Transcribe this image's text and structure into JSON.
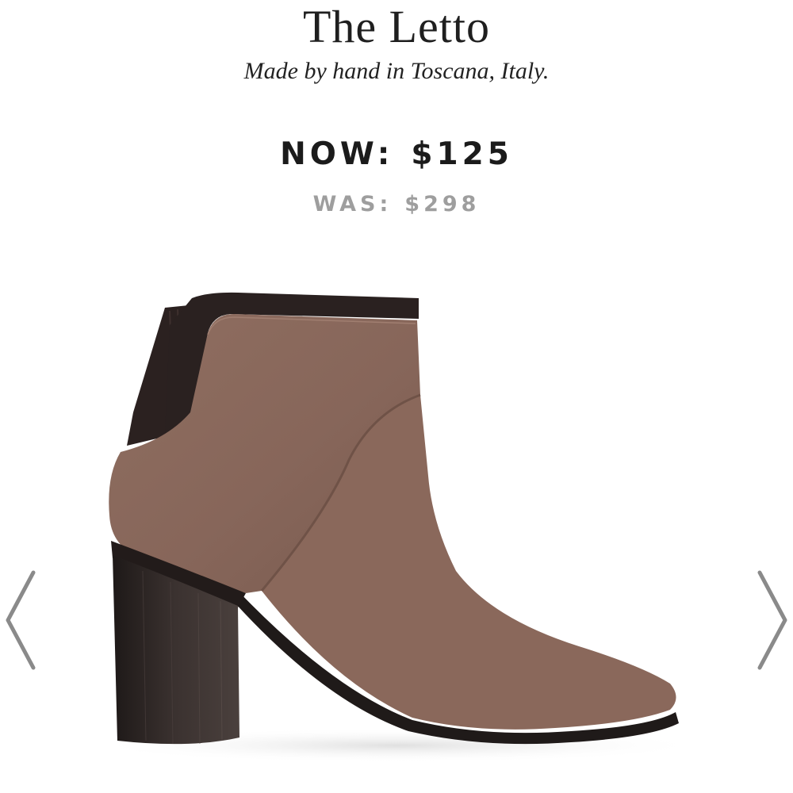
{
  "product": {
    "title": "The Letto",
    "subtitle": "Made by hand in Toscana, Italy.",
    "image_name": "brown suede ankle boot with block heel"
  },
  "pricing": {
    "now_label": "NOW:",
    "now_amount": "$125",
    "was_label": "WAS:",
    "was_amount": "$298"
  },
  "carousel": {
    "prev_icon": "chevron-left-icon",
    "next_icon": "chevron-right-icon",
    "arrow_color": "#8a8a8a"
  },
  "colors": {
    "suede": "#8b6a5c",
    "heel": "#2a2321",
    "now_price": "#1b1b1b",
    "was_price": "#9e9e9e"
  }
}
